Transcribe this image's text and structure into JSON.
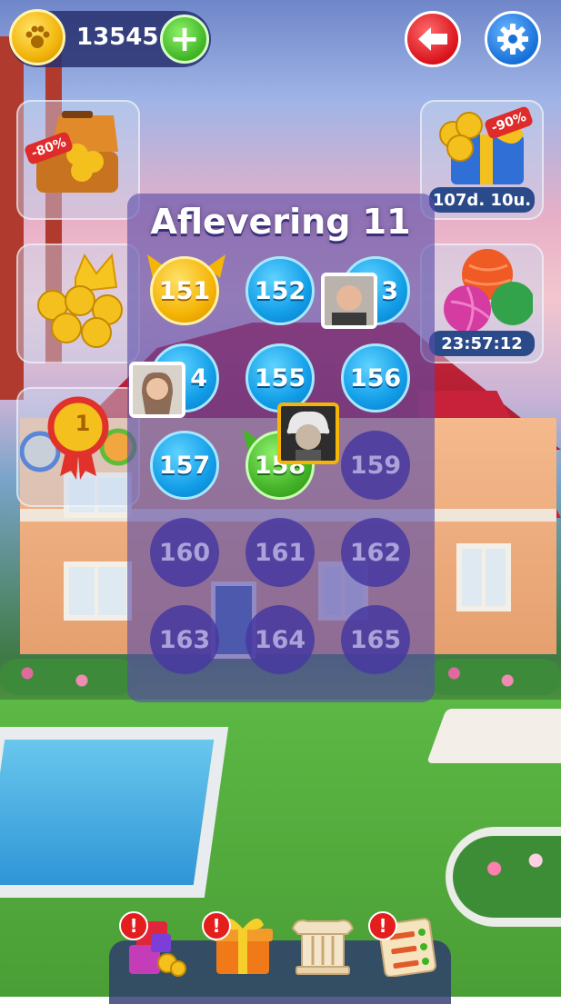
{
  "header": {
    "coins": "13545",
    "coin_icon": "paw-coin-icon",
    "add_coins_icon": "plus-icon",
    "back_icon": "arrow-left-icon",
    "settings_icon": "gear-icon"
  },
  "left_offers": [
    {
      "name": "coin-chest",
      "badge": "-80%"
    },
    {
      "name": "coin-crown"
    },
    {
      "name": "medals-ranking",
      "medal_text": "1"
    }
  ],
  "right_offers": [
    {
      "name": "gift-offer",
      "badge": "-90%",
      "timer": "107d. 10u."
    },
    {
      "name": "yarn-offer",
      "timer": "23:57:12"
    }
  ],
  "episode": {
    "title": "Aflevering 11",
    "levels": [
      {
        "num": "151",
        "state": "gold"
      },
      {
        "num": "152",
        "state": "blue"
      },
      {
        "num": "153",
        "state": "blue",
        "visible_text": "3"
      },
      {
        "num": "154",
        "state": "blue",
        "visible_text": "4"
      },
      {
        "num": "155",
        "state": "blue"
      },
      {
        "num": "156",
        "state": "blue"
      },
      {
        "num": "157",
        "state": "blue"
      },
      {
        "num": "158",
        "state": "green",
        "visible_text": "158"
      },
      {
        "num": "159",
        "state": "locked"
      },
      {
        "num": "160",
        "state": "locked"
      },
      {
        "num": "161",
        "state": "locked"
      },
      {
        "num": "162",
        "state": "locked"
      },
      {
        "num": "163",
        "state": "locked"
      },
      {
        "num": "164",
        "state": "locked"
      },
      {
        "num": "165",
        "state": "locked"
      }
    ]
  },
  "bottom_nav": [
    {
      "name": "blocks-offer",
      "alert": "!"
    },
    {
      "name": "gift-box",
      "alert": "!"
    },
    {
      "name": "pillar-building"
    },
    {
      "name": "task-list",
      "alert": "!"
    }
  ]
}
